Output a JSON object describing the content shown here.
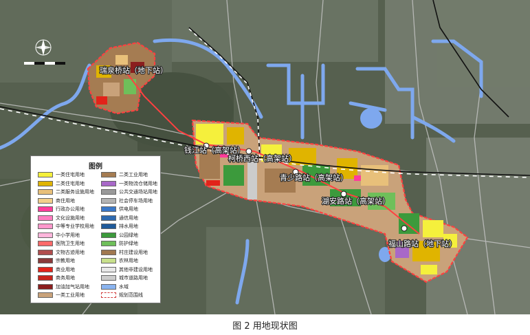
{
  "stations": [
    {
      "id": "s1",
      "label": "瑞泉桥站（地下站）"
    },
    {
      "id": "s2",
      "label": "钱江站（高架站）"
    },
    {
      "id": "s3",
      "label": "柯桥西站（高架站）"
    },
    {
      "id": "s4",
      "label": "青少路站（高架站）"
    },
    {
      "id": "s5",
      "label": "湖安路站（高架站）"
    },
    {
      "id": "s6",
      "label": "福山路站（地下站）"
    }
  ],
  "legend": {
    "title": "图例",
    "items": [
      {
        "label": "一类住宅用地",
        "color": "#f5f03c"
      },
      {
        "label": "二类住宅用地",
        "color": "#e0b400"
      },
      {
        "label": "二类服务设施用地",
        "color": "#e8c07a"
      },
      {
        "label": "商住用地",
        "color": "#f3d08c"
      },
      {
        "label": "行政办公用地",
        "color": "#ff3c9a"
      },
      {
        "label": "文化设施用地",
        "color": "#ff7dc0"
      },
      {
        "label": "中等专业学校用地",
        "color": "#ff98cc"
      },
      {
        "label": "中小学用地",
        "color": "#ffb6dc"
      },
      {
        "label": "医院卫生用地",
        "color": "#ff6a6a"
      },
      {
        "label": "文物古迹用地",
        "color": "#b04c4c"
      },
      {
        "label": "宗教用地",
        "color": "#8a3a3a"
      },
      {
        "label": "商业用地",
        "color": "#e2231a"
      },
      {
        "label": "商务用地",
        "color": "#c8241c"
      },
      {
        "label": "加油加气站用地",
        "color": "#8b1e1e"
      },
      {
        "label": "一类工业用地",
        "color": "#c9a27a"
      },
      {
        "label": "二类工业用地",
        "color": "#a57c52"
      },
      {
        "label": "一类物流仓储用地",
        "color": "#a868c8"
      },
      {
        "label": "公共交通场站用地",
        "color": "#9a9a9a"
      },
      {
        "label": "社会停车场用地",
        "color": "#b4b4b4"
      },
      {
        "label": "供电用地",
        "color": "#3a78c8"
      },
      {
        "label": "通信用地",
        "color": "#2e6ab0"
      },
      {
        "label": "排水用地",
        "color": "#1f5a9a"
      },
      {
        "label": "公园绿地",
        "color": "#3c9a3c"
      },
      {
        "label": "防护绿地",
        "color": "#6fbf5a"
      },
      {
        "label": "村庄建设用地",
        "color": "#a07850"
      },
      {
        "label": "农林用地",
        "color": "#c8e08c"
      },
      {
        "label": "其他非建设用地",
        "color": "#e8e8e8"
      },
      {
        "label": "城市道路用地",
        "color": "#cccccc"
      },
      {
        "label": "水域",
        "color": "#8ab4f0"
      },
      {
        "label": "规划范围线",
        "color": "#d23c3c"
      }
    ]
  },
  "caption": "图 2  用地现状图",
  "colors": {
    "satellite_base": "#4f5a48",
    "water": "#7ea8ee",
    "boundary": "#ff4040",
    "railway": "#111111",
    "road": "#c8c8c8"
  }
}
